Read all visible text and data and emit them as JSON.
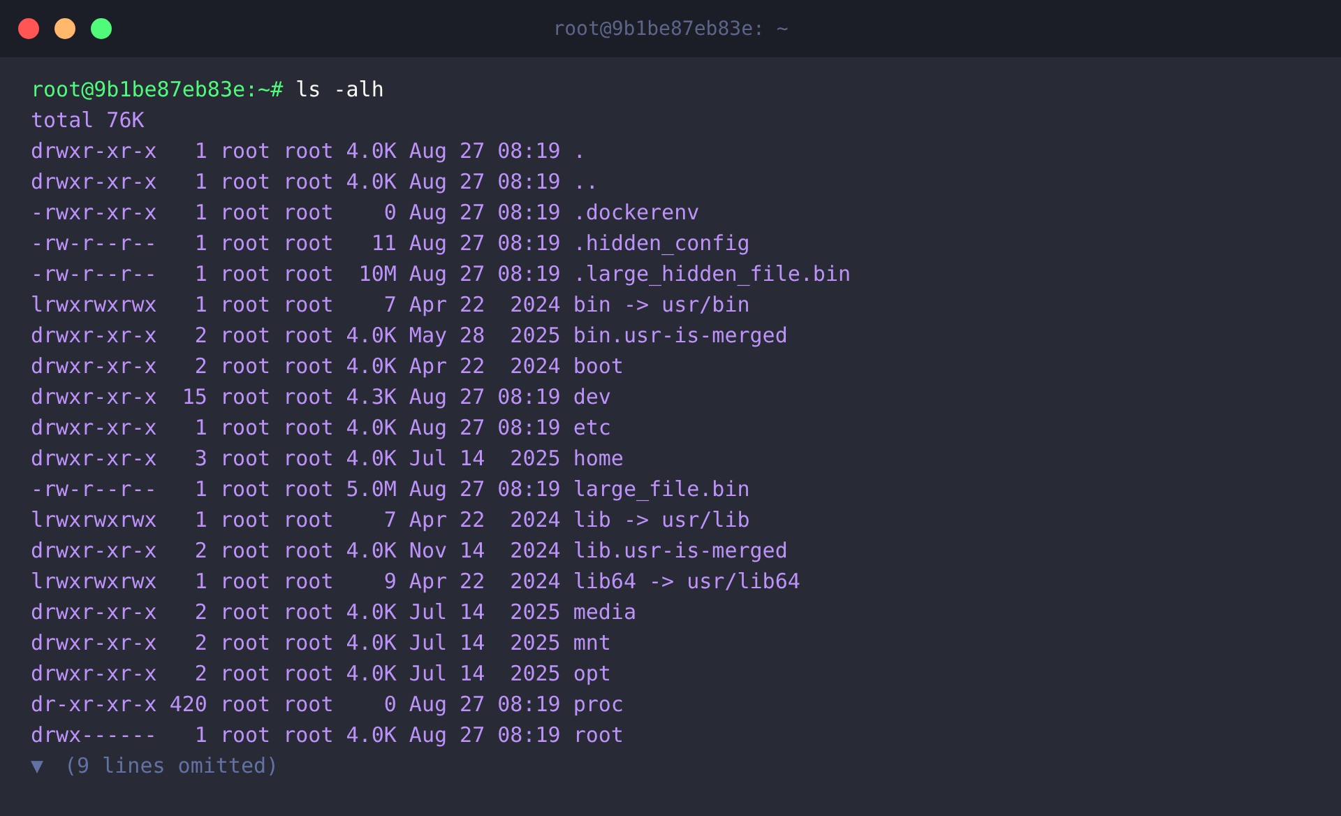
{
  "window": {
    "title": "root@9b1be87eb83e: ~"
  },
  "terminal": {
    "prompt": "root@9b1be87eb83e:~#",
    "command": "ls -alh",
    "output": [
      "total 76K",
      "drwxr-xr-x   1 root root 4.0K Aug 27 08:19 .",
      "drwxr-xr-x   1 root root 4.0K Aug 27 08:19 ..",
      "-rwxr-xr-x   1 root root    0 Aug 27 08:19 .dockerenv",
      "-rw-r--r--   1 root root   11 Aug 27 08:19 .hidden_config",
      "-rw-r--r--   1 root root  10M Aug 27 08:19 .large_hidden_file.bin",
      "lrwxrwxrwx   1 root root    7 Apr 22  2024 bin -> usr/bin",
      "drwxr-xr-x   2 root root 4.0K May 28  2025 bin.usr-is-merged",
      "drwxr-xr-x   2 root root 4.0K Apr 22  2024 boot",
      "drwxr-xr-x  15 root root 4.3K Aug 27 08:19 dev",
      "drwxr-xr-x   1 root root 4.0K Aug 27 08:19 etc",
      "drwxr-xr-x   3 root root 4.0K Jul 14  2025 home",
      "-rw-r--r--   1 root root 5.0M Aug 27 08:19 large_file.bin",
      "lrwxrwxrwx   1 root root    7 Apr 22  2024 lib -> usr/lib",
      "drwxr-xr-x   2 root root 4.0K Nov 14  2024 lib.usr-is-merged",
      "lrwxrwxrwx   1 root root    9 Apr 22  2024 lib64 -> usr/lib64",
      "drwxr-xr-x   2 root root 4.0K Jul 14  2025 media",
      "drwxr-xr-x   2 root root 4.0K Jul 14  2025 mnt",
      "drwxr-xr-x   2 root root 4.0K Jul 14  2025 opt",
      "dr-xr-xr-x 420 root root    0 Aug 27 08:19 proc",
      "drwx------   1 root root 4.0K Aug 27 08:19 root"
    ],
    "fold": {
      "icon": "▼",
      "label": "(9 lines omitted)"
    }
  }
}
